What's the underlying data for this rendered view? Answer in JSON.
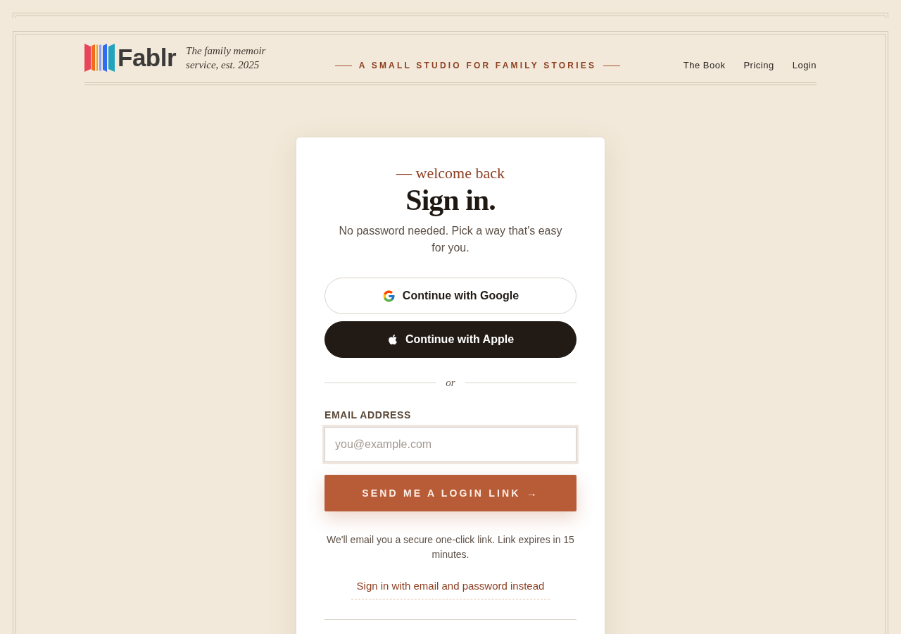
{
  "header": {
    "logo": {
      "wordmark": "Fablr"
    },
    "tagline": "The family memoir service, est. 2025",
    "motto": "A SMALL STUDIO FOR FAMILY STORIES",
    "nav": [
      {
        "label": "The Book"
      },
      {
        "label": "Pricing"
      },
      {
        "label": "Login"
      }
    ]
  },
  "card": {
    "eyebrow": "— welcome back",
    "title": "Sign in.",
    "subtitle": "No password needed. Pick a way that's easy for you.",
    "providers": [
      {
        "kind": "google",
        "label": "Continue with Google"
      },
      {
        "kind": "apple",
        "label": "Continue with Apple"
      }
    ],
    "divider": "or",
    "email": {
      "label": "EMAIL ADDRESS",
      "placeholder": "you@example.com"
    },
    "submit": {
      "label": "SEND ME A LOGIN LINK",
      "arrow": "→"
    },
    "note": "We'll email you a secure one-click link. Link expires in 15 minutes.",
    "alt_link": "Sign in with email and password instead"
  }
}
